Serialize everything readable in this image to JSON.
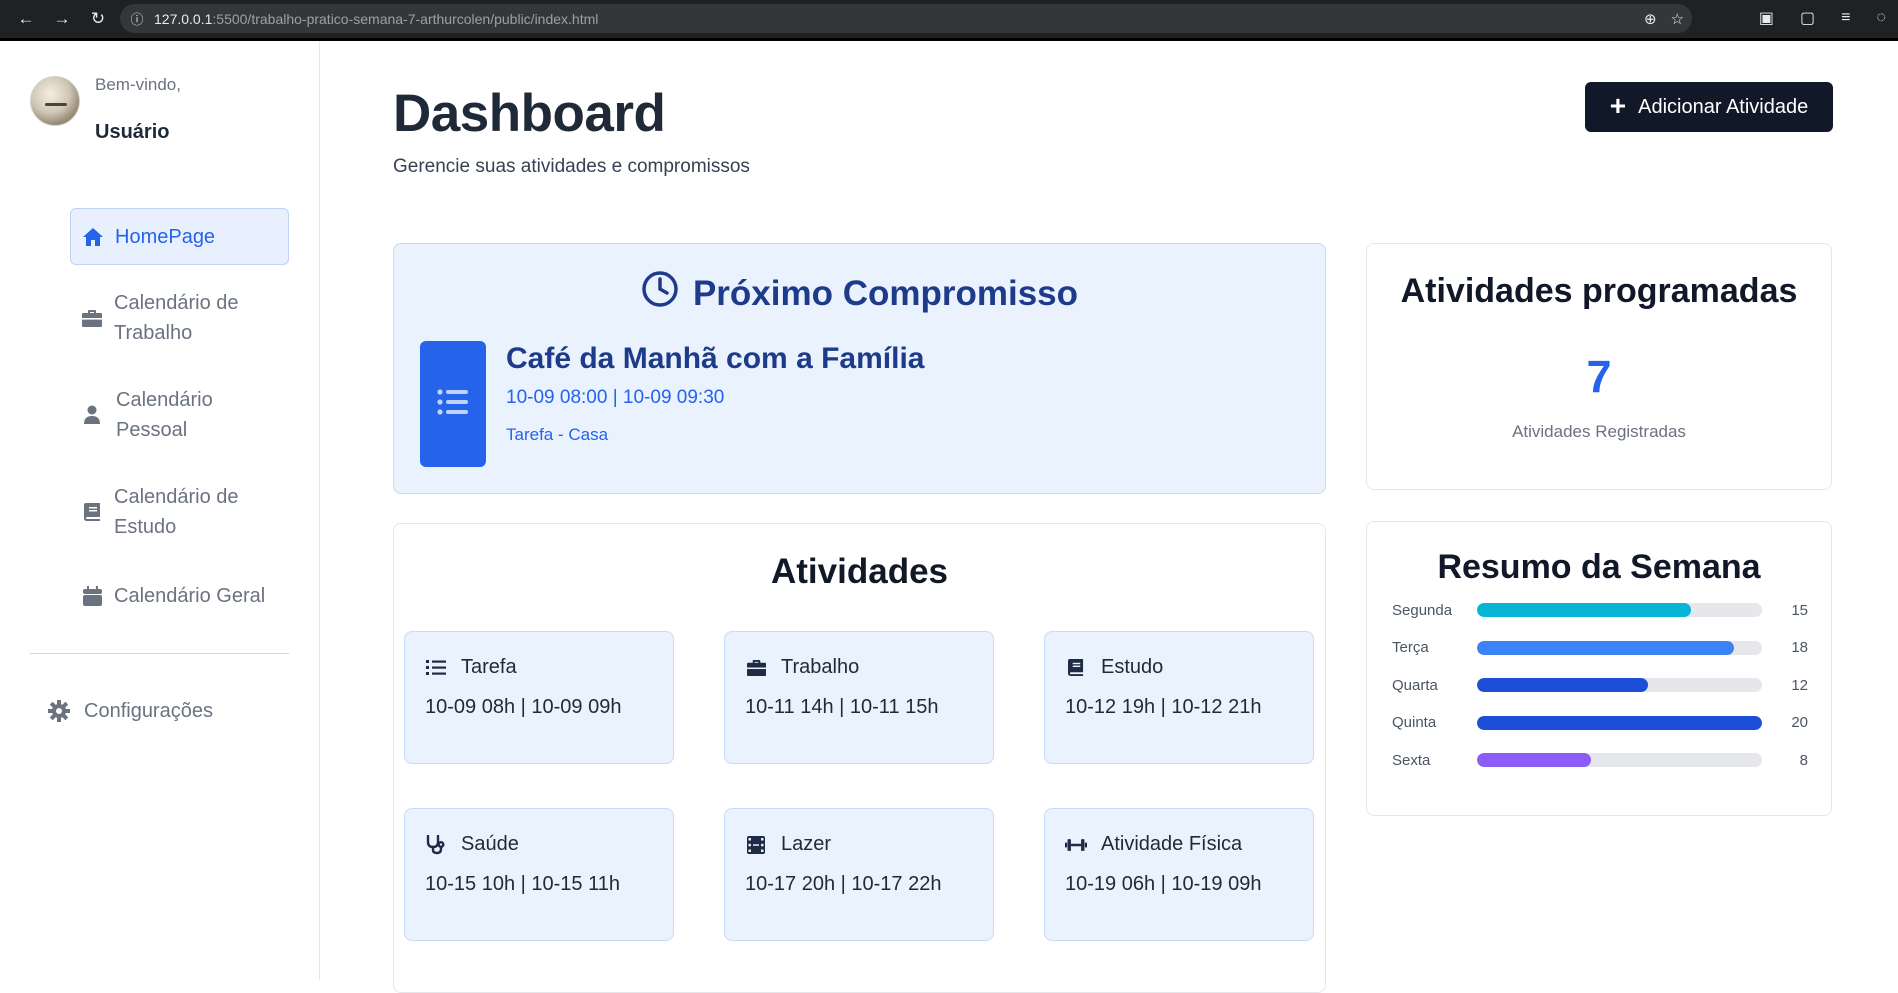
{
  "browser": {
    "url_host": "127.0.0.1",
    "url_rest": ":5500/trabalho-pratico-semana-7-arthurcolen/public/index.html"
  },
  "sidebar": {
    "welcome": "Bem-vindo,",
    "username": "Usuário",
    "items": [
      {
        "label": "HomePage",
        "icon": "home-icon",
        "active": true
      },
      {
        "label_line1": "Calendário de",
        "label_line2": "Trabalho",
        "icon": "briefcase-icon"
      },
      {
        "label_line1": "Calendário",
        "label_line2": "Pessoal",
        "icon": "user-icon"
      },
      {
        "label_line1": "Calendário de",
        "label_line2": "Estudo",
        "icon": "book-icon"
      },
      {
        "label": "Calendário Geral",
        "icon": "calendar-icon"
      }
    ],
    "settings": {
      "label": "Configurações",
      "icon": "gear-icon"
    }
  },
  "header": {
    "title": "Dashboard",
    "subtitle": "Gerencie suas atividades e compromissos",
    "add_button": "Adicionar Atividade"
  },
  "next_appointment": {
    "title": "Próximo Compromisso",
    "name": "Café da Manhã com a Família",
    "time": "10-09 08:00 | 10-09 09:30",
    "category": "Tarefa - Casa"
  },
  "scheduled": {
    "title": "Atividades programadas",
    "count": "7",
    "label": "Atividades Registradas"
  },
  "activities": {
    "title": "Atividades",
    "items": [
      {
        "label": "Tarefa",
        "when": "10-09 08h | 10-09 09h",
        "icon": "list-icon"
      },
      {
        "label": "Trabalho",
        "when": "10-11 14h | 10-11 15h",
        "icon": "briefcase-icon"
      },
      {
        "label": "Estudo",
        "when": "10-12 19h | 10-12 21h",
        "icon": "book-icon"
      },
      {
        "label": "Saúde",
        "when": "10-15 10h | 10-15 11h",
        "icon": "stethoscope-icon"
      },
      {
        "label": "Lazer",
        "when": "10-17 20h | 10-17 22h",
        "icon": "film-icon"
      },
      {
        "label": "Atividade Física",
        "when": "10-19 06h | 10-19 09h",
        "icon": "dumbbell-icon"
      }
    ]
  },
  "week_summary": {
    "title": "Resumo da Semana",
    "max": 20,
    "rows": [
      {
        "day": "Segunda",
        "value": 15,
        "color": "#06b6d4"
      },
      {
        "day": "Terça",
        "value": 18,
        "color": "#3b82f6"
      },
      {
        "day": "Quarta",
        "value": 12,
        "color": "#1d4ed8"
      },
      {
        "day": "Quinta",
        "value": 20,
        "color": "#1d4ed8"
      },
      {
        "day": "Sexta",
        "value": 8,
        "color": "#8b5cf6"
      }
    ]
  }
}
